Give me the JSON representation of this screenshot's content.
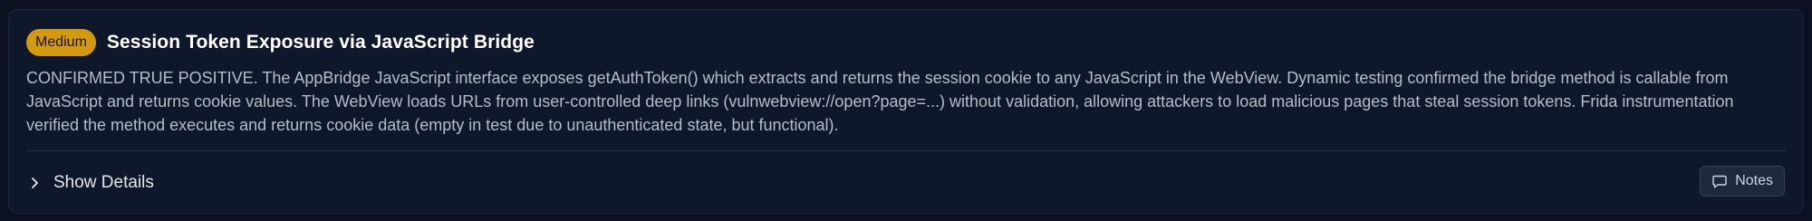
{
  "finding": {
    "severity": "Medium",
    "title": "Session Token Exposure via JavaScript Bridge",
    "description": "CONFIRMED TRUE POSITIVE. The AppBridge JavaScript interface exposes getAuthToken() which extracts and returns the session cookie to any JavaScript in the WebView. Dynamic testing confirmed the bridge method is callable from JavaScript and returns cookie values. The WebView loads URLs from user-controlled deep links (vulnwebview://open?page=...) without validation, allowing attackers to load malicious pages that steal session tokens. Frida instrumentation verified the method executes and returns cookie data (empty in test due to unauthenticated state, but functional).",
    "details_label": "Show Details",
    "notes_label": "Notes"
  },
  "colors": {
    "severity_medium": "#d49a0f",
    "card_background": "#0f172a",
    "page_background": "#0b1120"
  },
  "icons": {
    "details_toggle": "chevron-right-icon",
    "notes": "message-square-icon"
  }
}
